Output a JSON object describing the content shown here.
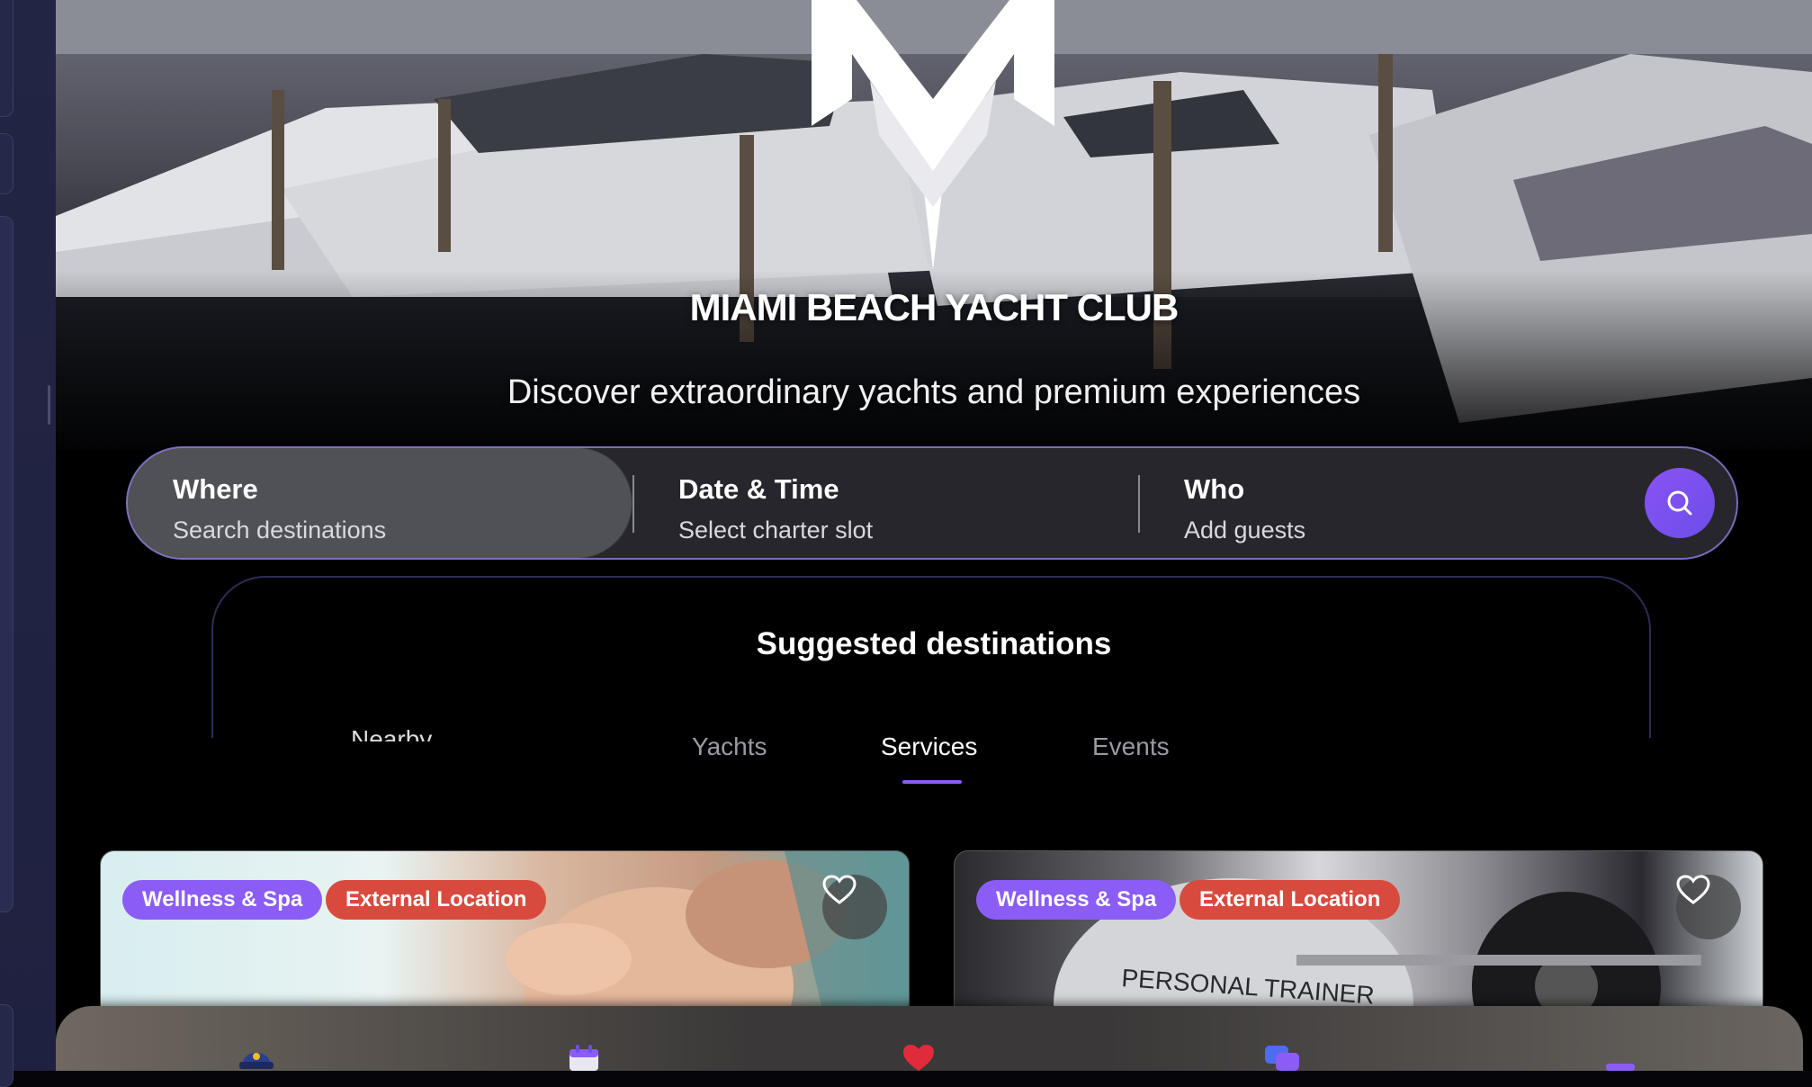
{
  "hero": {
    "brand": "MIAMI BEACH YACHT CLUB",
    "tagline": "Discover extraordinary yachts and premium experiences"
  },
  "search": {
    "where_label": "Where",
    "where_sub": "Search destinations",
    "date_label": "Date & Time",
    "date_sub": "Select charter slot",
    "who_label": "Who",
    "who_sub": "Add guests",
    "button_icon": "search-icon"
  },
  "suggested": {
    "title": "Suggested destinations",
    "tabs": [
      {
        "label": "Nearby"
      },
      {
        "label": "Yachts"
      },
      {
        "label": "Services"
      },
      {
        "label": "Events"
      }
    ],
    "active_tab": "Services"
  },
  "cards": [
    {
      "category": "Wellness & Spa",
      "location_type": "External Location",
      "favorite_icon": "heart-outline-icon"
    },
    {
      "category": "Wellness & Spa",
      "location_type": "External Location",
      "favorite_icon": "heart-outline-icon",
      "image_text": "PERSONAL TRAINER"
    }
  ],
  "bottom_nav": {
    "items": [
      {
        "icon": "captain-hat-icon"
      },
      {
        "icon": "calendar-icon"
      },
      {
        "icon": "heart-icon"
      },
      {
        "icon": "chat-icon"
      },
      {
        "icon": "profile-icon"
      }
    ]
  },
  "colors": {
    "accent": "#8b5cf6",
    "tag_red": "#d94a3e",
    "search_border": "#7b6ab8"
  }
}
